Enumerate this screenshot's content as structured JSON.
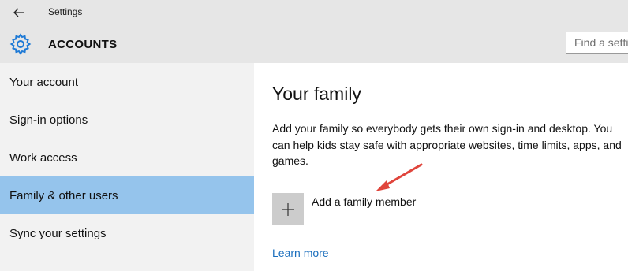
{
  "window": {
    "title": "Settings"
  },
  "header": {
    "title": "ACCOUNTS",
    "search_placeholder": "Find a setting"
  },
  "sidebar": {
    "items": [
      {
        "label": "Your account"
      },
      {
        "label": "Sign-in options"
      },
      {
        "label": "Work access"
      },
      {
        "label": "Family & other users",
        "selected": true
      },
      {
        "label": "Sync your settings"
      }
    ]
  },
  "main": {
    "title": "Your family",
    "description": "Add your family so everybody gets their own sign-in and desktop. You can help kids stay safe with appropriate websites, time limits, apps, and games.",
    "add_label": "Add a family member",
    "learn_more": "Learn more"
  },
  "icons": {
    "back": "back-arrow-icon",
    "settings": "gear-icon",
    "add": "plus-icon"
  },
  "colors": {
    "accent": "#95c4ec",
    "link": "#1a6ebd",
    "annotation": "#e0453c"
  }
}
